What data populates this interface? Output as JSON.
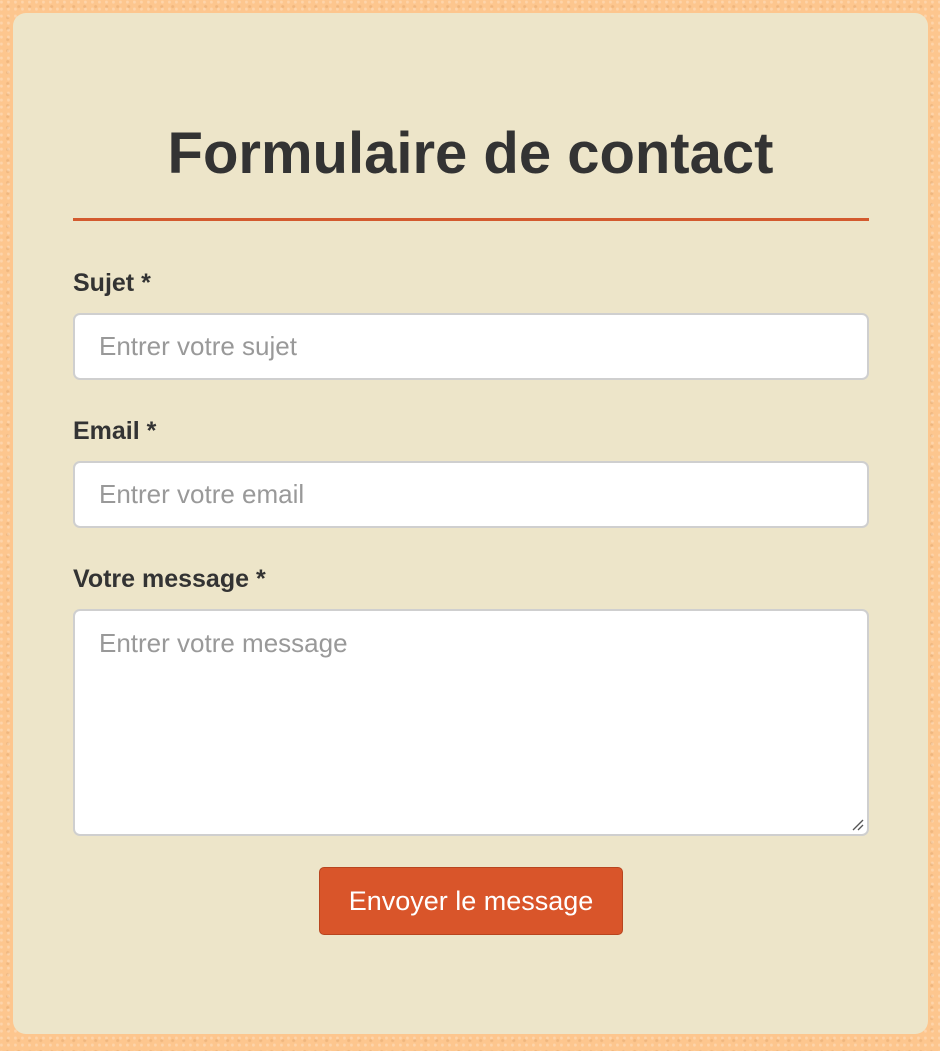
{
  "form": {
    "title": "Formulaire de contact",
    "subject": {
      "label": "Sujet *",
      "placeholder": "Entrer votre sujet",
      "value": ""
    },
    "email": {
      "label": "Email *",
      "placeholder": "Entrer votre email",
      "value": ""
    },
    "message": {
      "label": "Votre message *",
      "placeholder": "Entrer votre message",
      "value": ""
    },
    "submit_label": "Envoyer le message"
  },
  "colors": {
    "page_background": "#fdc68e",
    "card_background": "#ede5c9",
    "accent": "#d9552a",
    "text": "#333333"
  },
  "icons": {
    "resize_handle": "resize-grip-icon"
  }
}
